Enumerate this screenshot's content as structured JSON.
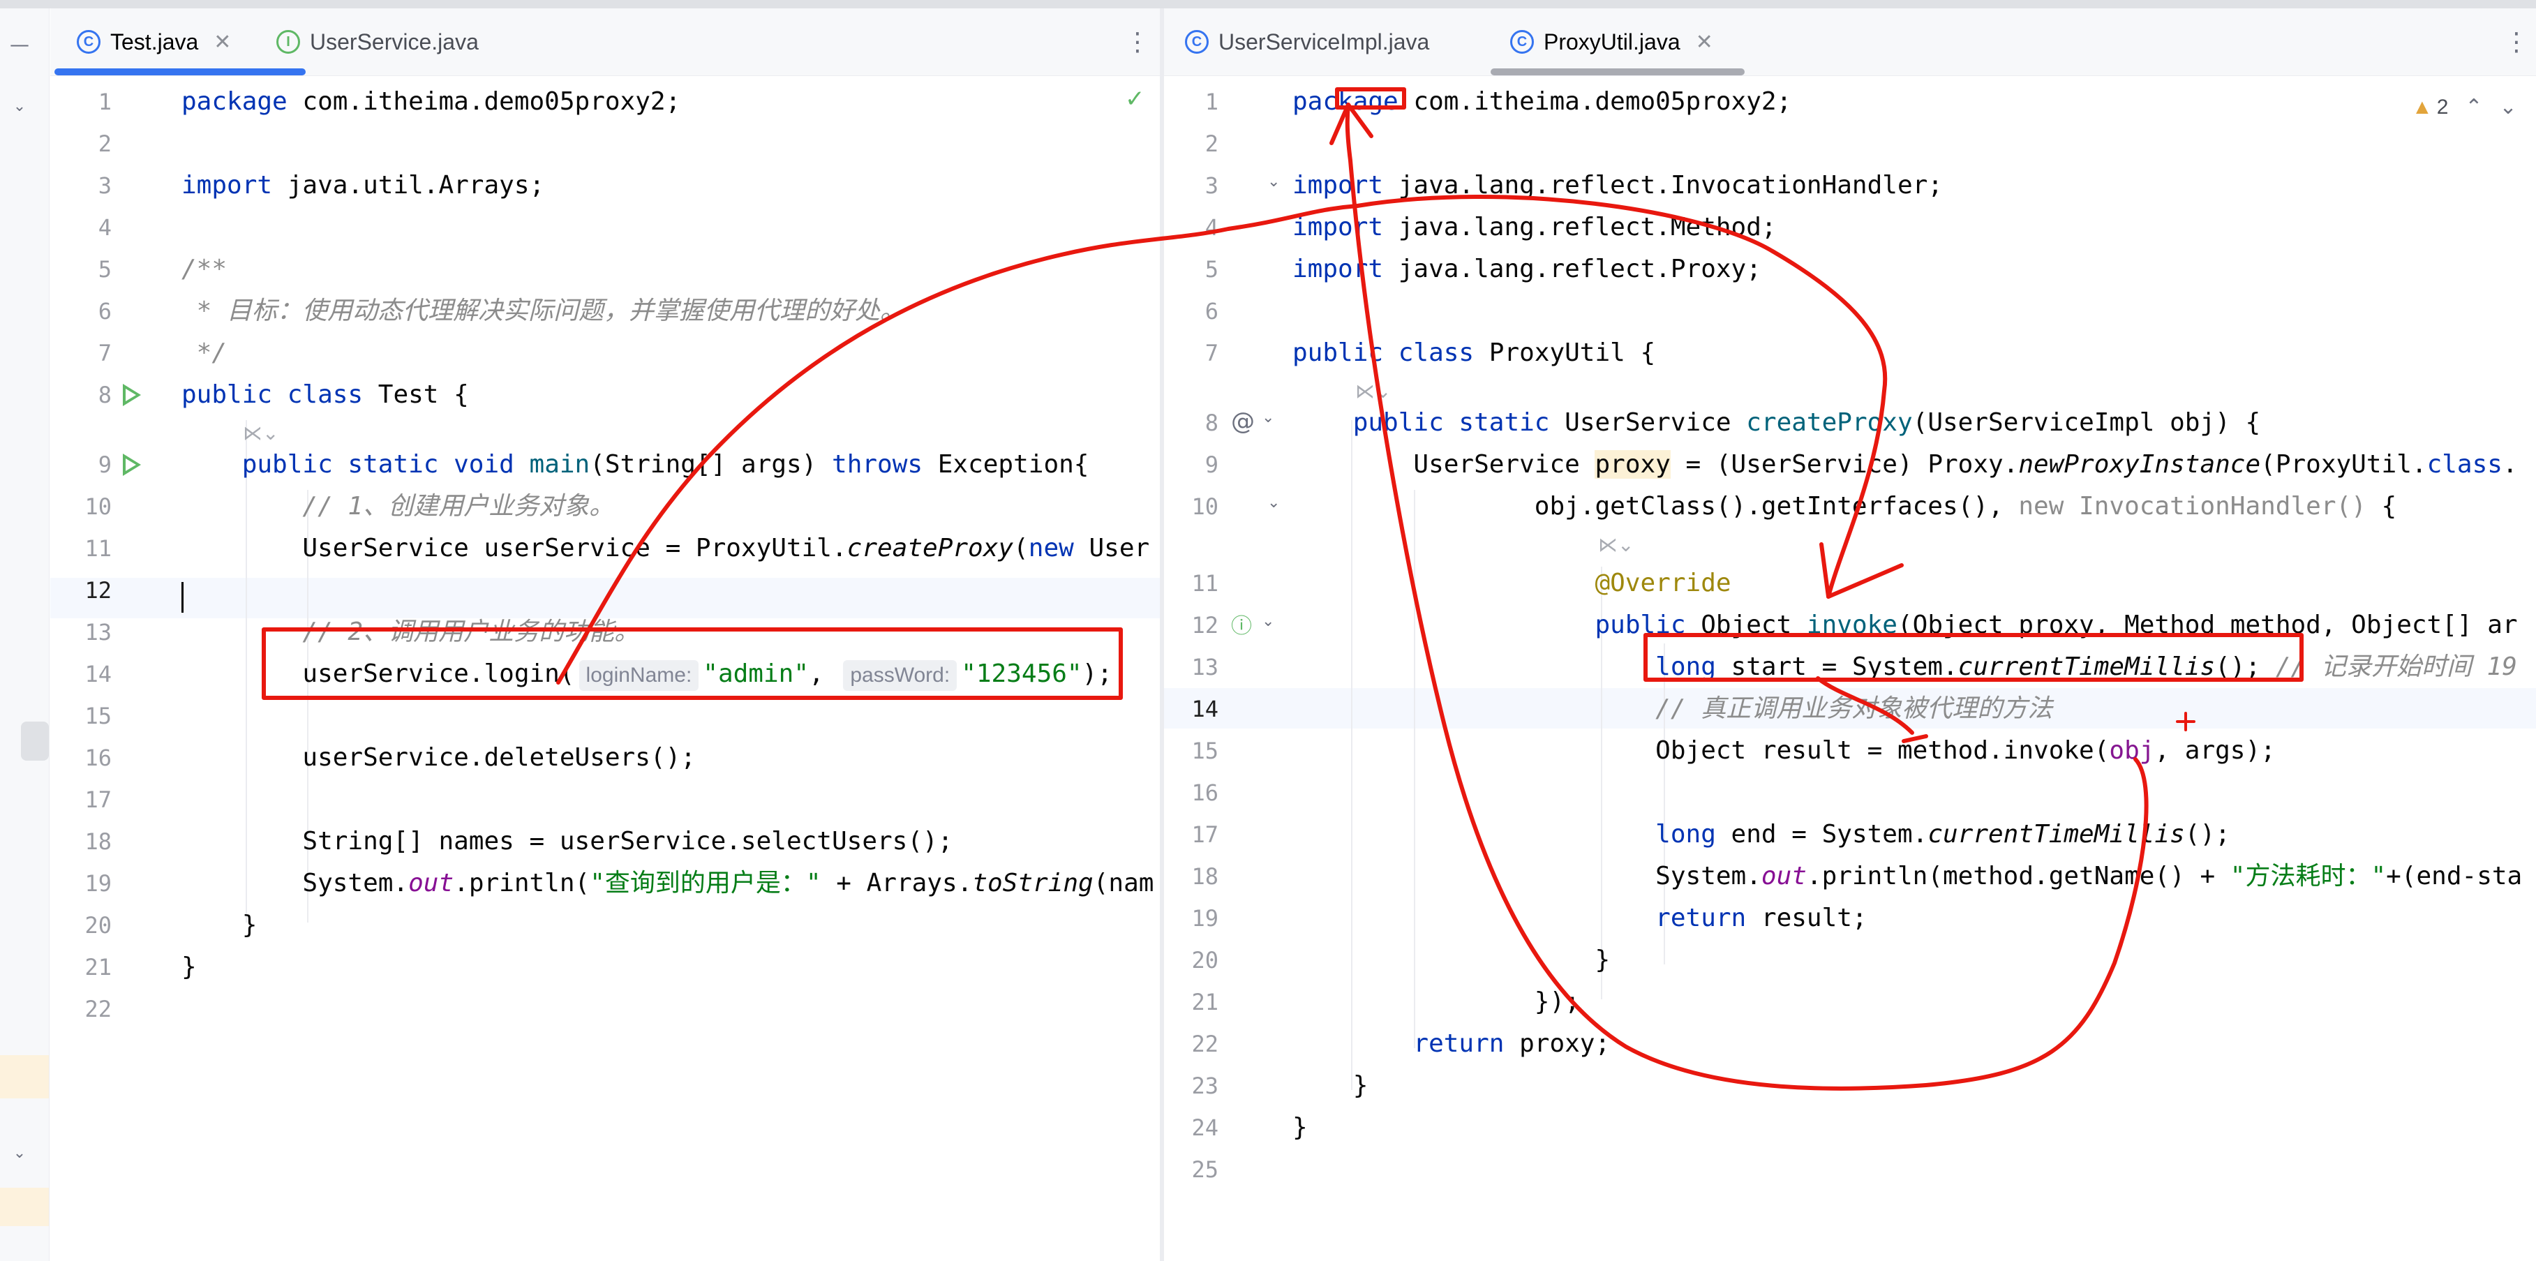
{
  "left_pane": {
    "tabs": [
      {
        "label": "Test.java",
        "active": true,
        "closable": true
      },
      {
        "label": "UserService.java",
        "active": false,
        "closable": false
      }
    ],
    "inline_hints": {
      "param1": "loginName:",
      "param2": "passWord:"
    }
  },
  "right_pane": {
    "tabs": [
      {
        "label": "UserServiceImpl.java",
        "active": false,
        "closable": false
      },
      {
        "label": "ProxyUtil.java",
        "active": true,
        "closable": true
      }
    ],
    "warnings_count": "2"
  },
  "colors": {
    "keyword": "#0033b3",
    "string": "#067d17",
    "comment": "#8c8c8c",
    "annotation_red": "#e8180f",
    "accent": "#3574f0",
    "run_green": "#5fb865"
  },
  "icons": [
    "class-icon",
    "interface-icon",
    "close-icon",
    "run-icon",
    "kebab-menu-icon",
    "warning-icon",
    "check-icon",
    "chevron-up-icon",
    "chevron-down-icon",
    "override-icon",
    "at-sign-icon"
  ]
}
